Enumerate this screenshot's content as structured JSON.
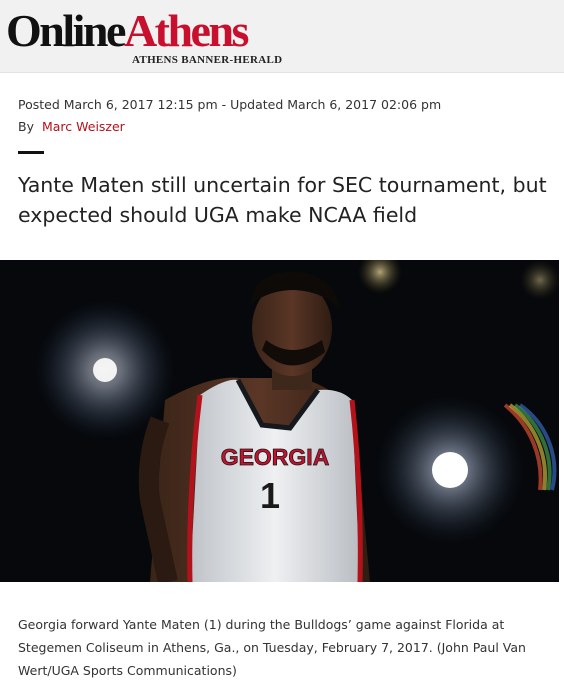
{
  "masthead": {
    "logo_part1": "Online",
    "logo_part2": "Athens",
    "tagline": "Athens Banner-Herald",
    "colors": {
      "logo_black": "#111111",
      "logo_red": "#c8102e"
    }
  },
  "article": {
    "meta": "Posted March 6, 2017 12:15 pm - Updated March 6, 2017 02:06 pm",
    "by_label": "By",
    "author": "Marc Weiszer",
    "headline": "Yante Maten still uncertain for SEC tournament, but expected should UGA make NCAA field",
    "photo": {
      "jersey_text": "GEORGIA",
      "jersey_number": "1"
    },
    "caption": "Georgia forward Yante Maten (1) during the Bulldogs’ game against Florida at Stegemen Coliseum in Athens, Ga., on Tuesday, February 7, 2017. (John Paul Van Wert/UGA Sports Communications)"
  },
  "colors": {
    "author_link": "#b3121b",
    "accent_rule": "#111111"
  }
}
